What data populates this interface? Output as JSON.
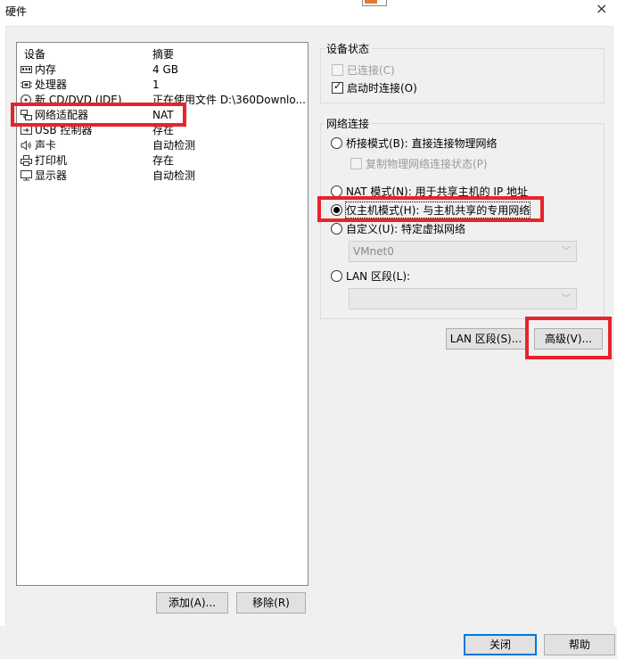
{
  "window": {
    "title": "硬件",
    "close_glyph": "×"
  },
  "device_list": {
    "col_device": "设备",
    "col_summary": "摘要",
    "rows": [
      {
        "icon": "memory-icon",
        "name": "内存",
        "summary": "4 GB"
      },
      {
        "icon": "processor-icon",
        "name": "处理器",
        "summary": "1"
      },
      {
        "icon": "cd-dvd-icon",
        "name": "新 CD/DVD (IDE)",
        "summary": "正在使用文件 D:\\360Downlo..."
      },
      {
        "icon": "network-adapter-icon",
        "name": "网络适配器",
        "summary": "NAT"
      },
      {
        "icon": "usb-icon",
        "name": "USB 控制器",
        "summary": "存在"
      },
      {
        "icon": "sound-card-icon",
        "name": "声卡",
        "summary": "自动检测"
      },
      {
        "icon": "printer-icon",
        "name": "打印机",
        "summary": "存在"
      },
      {
        "icon": "display-icon",
        "name": "显示器",
        "summary": "自动检测"
      }
    ],
    "add_button": "添加(A)...",
    "remove_button": "移除(R)"
  },
  "device_status": {
    "title": "设备状态",
    "connected_label": "已连接(C)",
    "connect_on_power_label": "启动时连接(O)"
  },
  "network": {
    "title": "网络连接",
    "bridged_label": "桥接模式(B): 直接连接物理网络",
    "replicate_label": "复制物理网络连接状态(P)",
    "nat_label": "NAT 模式(N): 用于共享主机的 IP 地址",
    "hostonly_label": "仅主机模式(H): 与主机共享的专用网络",
    "custom_label": "自定义(U): 特定虚拟网络",
    "custom_select_value": "VMnet0",
    "lan_label": "LAN 区段(L):",
    "lan_select_value": "",
    "lan_segments_button": "LAN 区段(S)...",
    "advanced_button": "高级(V)..."
  },
  "footer": {
    "close_button": "关闭",
    "help_button": "帮助"
  },
  "colors": {
    "highlight": "#e8232b",
    "focus_blue": "#0078d7"
  }
}
